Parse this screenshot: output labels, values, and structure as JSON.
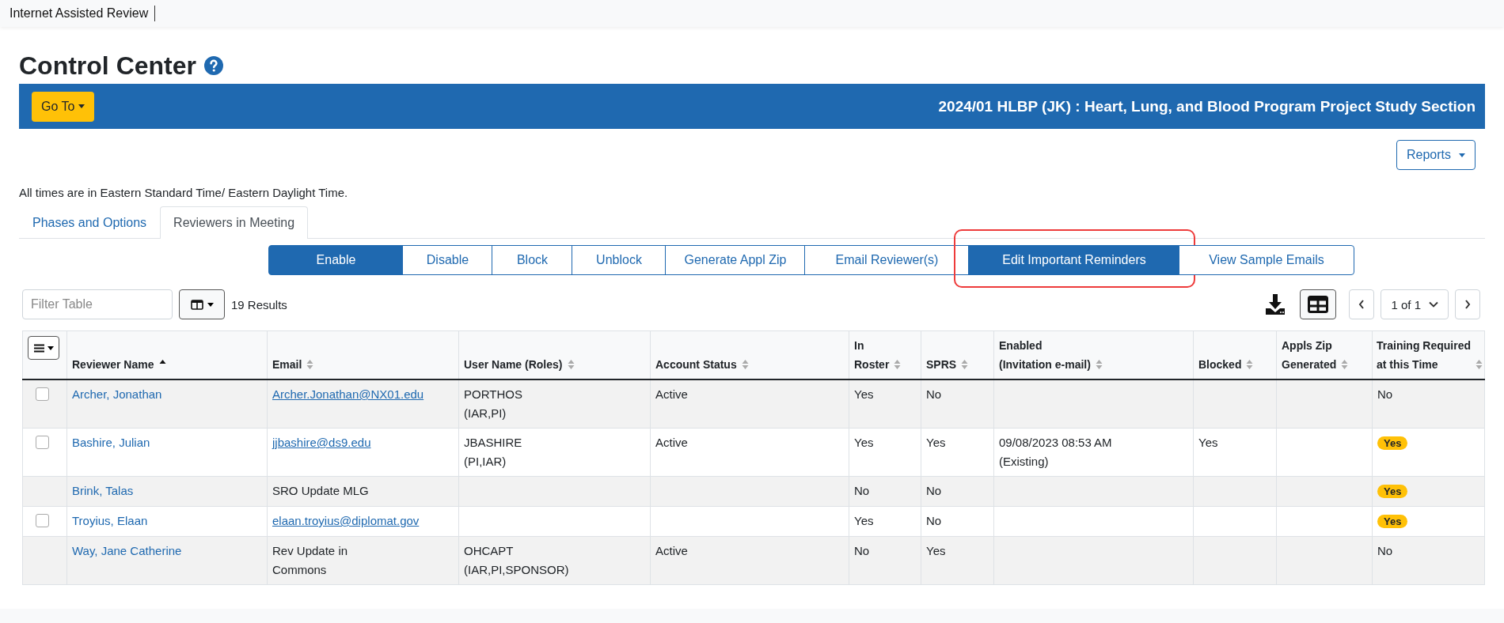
{
  "app_bar": {
    "title": "Internet Assisted Review"
  },
  "page": {
    "title": "Control Center"
  },
  "meeting_bar": {
    "goto_button": "Go To",
    "meeting_title": "2024/01 HLBP (JK) : Heart, Lung, and Blood Program Project Study Section"
  },
  "reports_button": "Reports",
  "timezone_note": "All times are in Eastern Standard Time/ Eastern Daylight Time.",
  "tabs": [
    {
      "label": "Phases and Options",
      "selected": false
    },
    {
      "label": "Reviewers in Meeting",
      "selected": true
    }
  ],
  "action_buttons": [
    {
      "label": "Enable",
      "active": true,
      "highlighted": false
    },
    {
      "label": "Disable",
      "active": false,
      "highlighted": false
    },
    {
      "label": "Block",
      "active": false,
      "highlighted": false
    },
    {
      "label": "Unblock",
      "active": false,
      "highlighted": false
    },
    {
      "label": "Generate Appl Zip",
      "active": false,
      "highlighted": false
    },
    {
      "label": "Email Reviewer(s)",
      "active": false,
      "highlighted": false
    },
    {
      "label": "Edit Important Reminders",
      "active": true,
      "highlighted": true
    },
    {
      "label": "View Sample Emails",
      "active": false,
      "highlighted": false
    }
  ],
  "table_toolbar": {
    "filter_placeholder": "Filter Table",
    "result_count": "19 Results",
    "pagination": "1 of 1"
  },
  "table": {
    "columns": [
      {
        "label": [
          "Reviewer Name"
        ],
        "sorted": true
      },
      {
        "label": [
          "Email"
        ],
        "sorted": false
      },
      {
        "label": [
          "User Name (Roles)"
        ],
        "sorted": false
      },
      {
        "label": [
          "Account Status"
        ],
        "sorted": false
      },
      {
        "label": [
          "In",
          "Roster"
        ],
        "sorted": false
      },
      {
        "label": [
          "SPRS"
        ],
        "sorted": false
      },
      {
        "label": [
          "Enabled",
          "(Invitation e-mail)"
        ],
        "sorted": false
      },
      {
        "label": [
          "Blocked"
        ],
        "sorted": false
      },
      {
        "label": [
          "Appls Zip",
          "Generated"
        ],
        "sorted": false
      },
      {
        "label": [
          "Training Required",
          "at this Time"
        ],
        "sorted": false
      }
    ],
    "rows": [
      {
        "checkbox": {
          "checked": false
        },
        "name": "Archer, Jonathan",
        "email": {
          "text": "Archer.Jonathan@NX01.edu",
          "kind": "link"
        },
        "user_name": "PORTHOS",
        "roles": "(IAR,PI)",
        "account_status": "Active",
        "in_roster": "Yes",
        "sprs": "No",
        "training": {
          "text": "No",
          "kind": "plain"
        }
      },
      {
        "checkbox": {
          "checked": false
        },
        "name": "Bashire, Julian",
        "email": {
          "text": "jjbashire@ds9.edu",
          "kind": "link"
        },
        "user_name": "JBASHIRE",
        "roles": "(PI,IAR)",
        "account_status": "Active",
        "in_roster": "Yes",
        "sprs": "Yes",
        "enabled": "09/08/2023 08:53 AM",
        "enabled_note": "(Existing)",
        "blocked": "Yes",
        "training": {
          "text": "Yes",
          "kind": "badge"
        }
      },
      {
        "name": "Brink, Talas",
        "email": {
          "text": "SRO Update MLG",
          "kind": "text"
        },
        "in_roster": "No",
        "sprs": "No",
        "training": {
          "text": "Yes",
          "kind": "badge"
        }
      },
      {
        "checkbox": {
          "checked": false
        },
        "name": "Troyius, Elaan",
        "email": {
          "text": "elaan.troyius@diplomat.gov",
          "kind": "link"
        },
        "in_roster": "Yes",
        "sprs": "No",
        "training": {
          "text": "Yes",
          "kind": "badge"
        }
      },
      {
        "name": "Way, Jane Catherine",
        "email": {
          "text": "Rev Update in Commons",
          "kind": "text"
        },
        "user_name": "OHCAPT",
        "roles": "(IAR,PI,SPONSOR)",
        "account_status": "Active",
        "in_roster": "No",
        "sprs": "Yes",
        "training": {
          "text": "No",
          "kind": "plain"
        }
      }
    ]
  }
}
